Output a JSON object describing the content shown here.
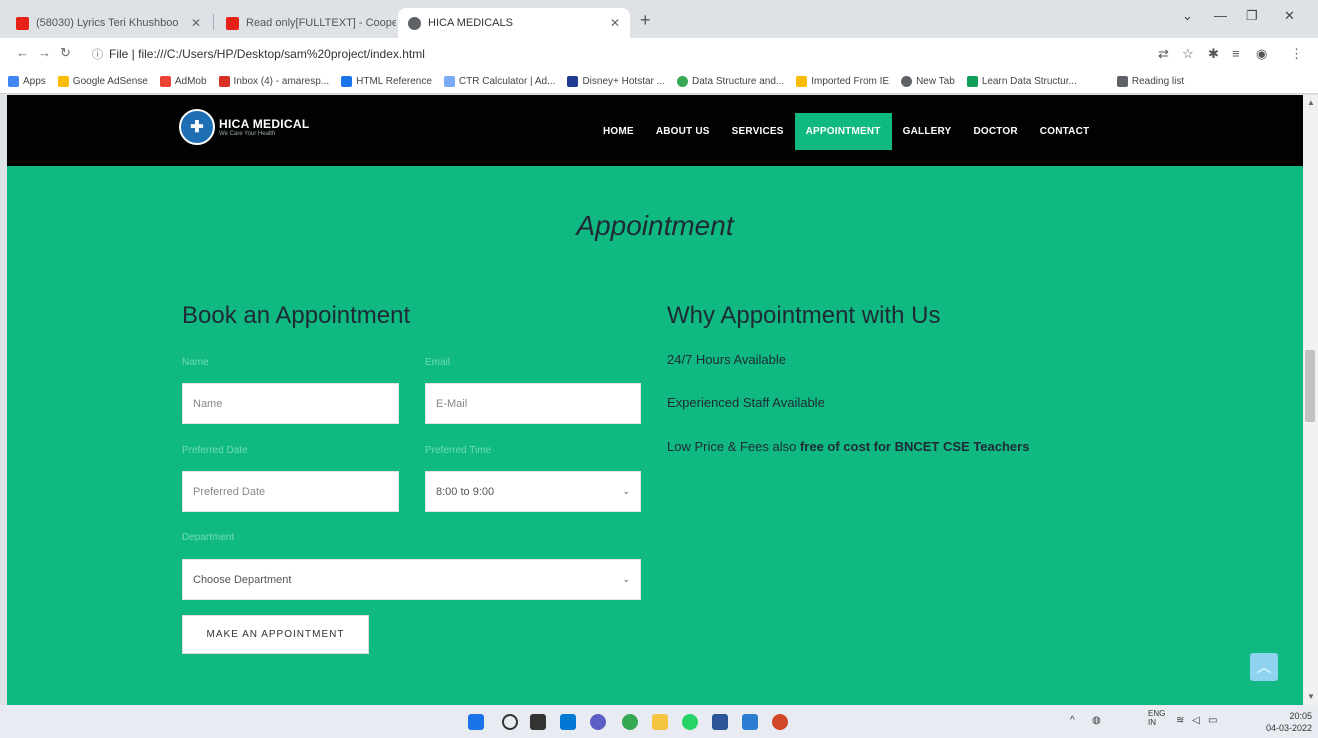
{
  "browser": {
    "tabs": [
      {
        "label": "(58030) Lyrics Teri Khushboo",
        "color": "#e62117"
      },
      {
        "label": "Read only[FULLTEXT] - Cooper",
        "color": "#e62117"
      },
      {
        "label": "HICA MEDICALS",
        "color": "#5f6368"
      }
    ],
    "address": "File | file:///C:/Users/HP/Desktop/sam%20project/index.html",
    "bookmarks": [
      "Apps",
      "Google AdSense",
      "AdMob",
      "Inbox (4) - amaresp...",
      "HTML Reference",
      "CTR Calculator | Ad...",
      "Disney+ Hotstar ...",
      "Data Structure and...",
      "Imported From IE",
      "New Tab",
      "Learn Data Structur...",
      "Reading list"
    ]
  },
  "site": {
    "brand": "HICA MEDICAL",
    "tagline": "We Care Your Health",
    "menu": [
      "HOME",
      "ABOUT US",
      "SERVICES",
      "APPOINTMENT",
      "GALLERY",
      "DOCTOR",
      "CONTACT"
    ],
    "page_title": "Appointment",
    "form": {
      "heading": "Book an Appointment",
      "name_label": "Name",
      "name_placeholder": "Name",
      "email_label": "Email",
      "email_placeholder": "E-Mail",
      "date_label": "Preferred Date",
      "date_placeholder": "Preferred Date",
      "time_label": "Preferred Time",
      "time_value": "8:00 to 9:00",
      "dept_label": "Department",
      "dept_value": "Choose Department",
      "submit": "MAKE AN APPOINTMENT"
    },
    "why": {
      "heading": "Why Appointment with Us",
      "item1": "24/7 Hours Available",
      "item2": "Experienced Staff Available",
      "item3_prefix": "Low Price & Fees also ",
      "item3_bold": "free of cost for BNCET CSE Teachers"
    }
  },
  "taskbar": {
    "lang": "ENG",
    "region": "IN",
    "time": "20:05",
    "date": "04-03-2022"
  }
}
